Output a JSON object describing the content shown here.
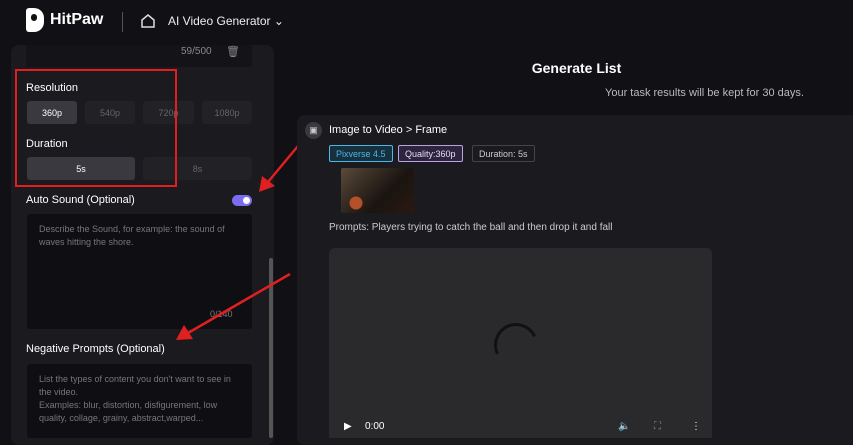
{
  "header": {
    "brand": "HitPaw",
    "app": "AI Video Generator"
  },
  "left": {
    "char_count": "59/500",
    "resolution": {
      "label": "Resolution",
      "options": [
        "360p",
        "540p",
        "720p",
        "1080p"
      ],
      "selected": "360p"
    },
    "duration": {
      "label": "Duration",
      "options": [
        "5s",
        "8s"
      ],
      "selected": "5s"
    },
    "auto_sound": {
      "label": "Auto Sound (Optional)",
      "enabled": true,
      "placeholder": "Describe the Sound, for example: the sound of waves hitting the shore.",
      "count": "0/140"
    },
    "negative": {
      "label": "Negative Prompts (Optional)",
      "placeholder": "List the types of content you don't want to see in the video.\nExamples: blur, distortion, disfigurement, low quality, collage, grainy,  abstract,warped..."
    }
  },
  "main": {
    "title": "Generate List",
    "subtitle": "Your task results will be kept for 30 days.",
    "task": {
      "title": "Image to Video > Frame",
      "tags": [
        "Pixverse 4.5",
        "Quality:360p",
        "Duration: 5s"
      ],
      "prompt": "Prompts: Players trying to catch the ball and then drop it and fall",
      "time": "0:00"
    }
  },
  "colors": {
    "accent": "#7b6cf2",
    "annotation": "#e02020",
    "model_tag": "#4fb6e8",
    "quality_tag": "#b9a4e0"
  }
}
